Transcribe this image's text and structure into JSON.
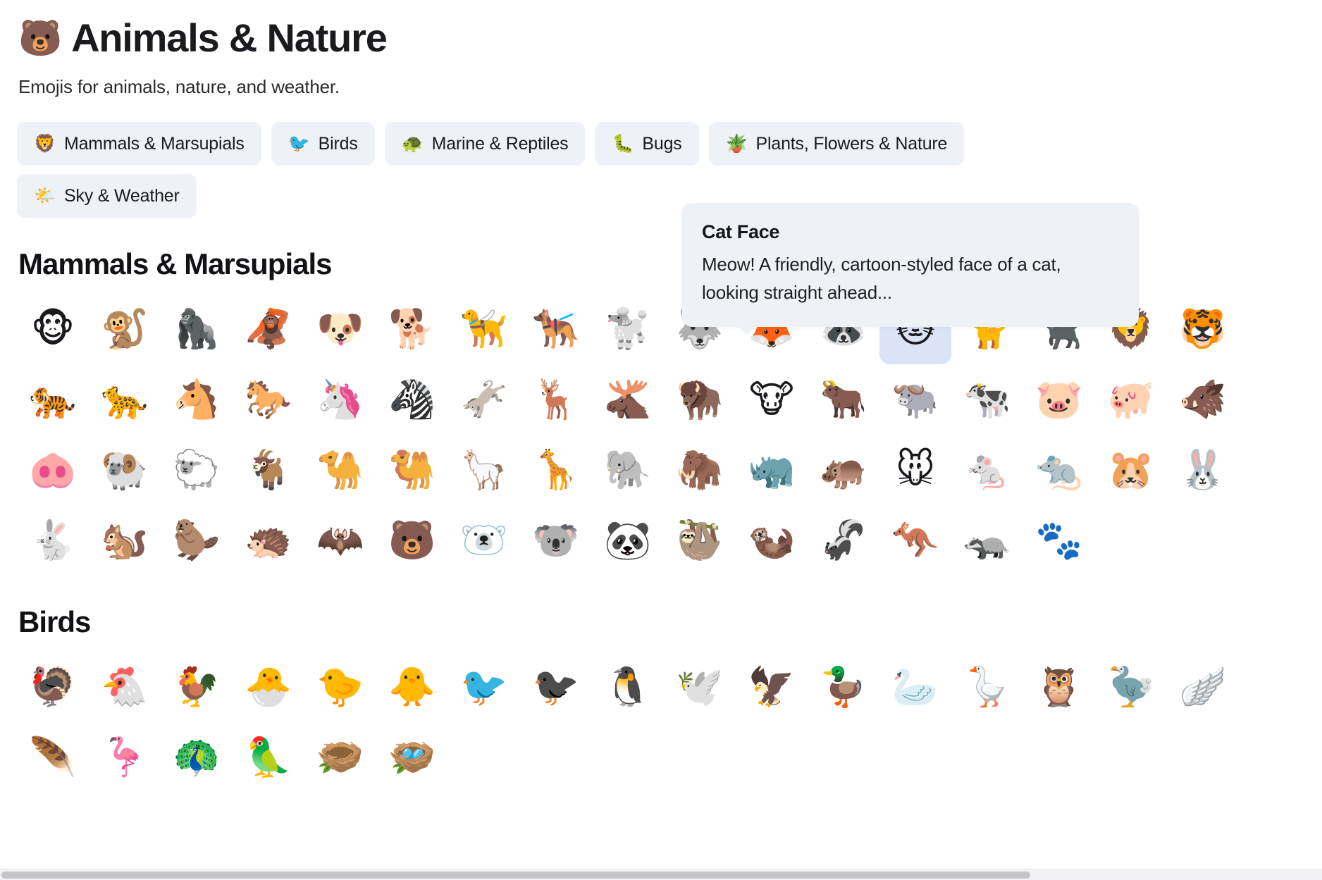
{
  "header": {
    "title_emoji": "🐻",
    "title_emoji_name": "bear-face-icon",
    "title": "Animals & Nature",
    "subtitle": "Emojis for animals, nature, and weather."
  },
  "chips": [
    {
      "emoji": "🦁",
      "icon_name": "lion-face-icon",
      "label": "Mammals & Marsupials"
    },
    {
      "emoji": "🐦",
      "icon_name": "bird-icon",
      "label": "Birds"
    },
    {
      "emoji": "🐢",
      "icon_name": "turtle-icon",
      "label": "Marine & Reptiles"
    },
    {
      "emoji": "🐛",
      "icon_name": "caterpillar-icon",
      "label": "Bugs"
    },
    {
      "emoji": "🪴",
      "icon_name": "potted-plant-icon",
      "label": "Plants, Flowers & Nature"
    },
    {
      "emoji": "🌤️",
      "icon_name": "sun-behind-cloud-icon",
      "label": "Sky & Weather"
    }
  ],
  "tooltip": {
    "title": "Cat Face",
    "body": "Meow! A friendly, cartoon-styled face of a cat, looking straight ahead...",
    "target_index": 12,
    "target_section": 0
  },
  "selection": {
    "section": 0,
    "index": 12,
    "highlight_color": "#dbe4f7"
  },
  "sections": [
    {
      "heading": "Mammals & Marsupials",
      "emojis": [
        {
          "glyph": "🐵",
          "name": "monkey-face"
        },
        {
          "glyph": "🐒",
          "name": "monkey"
        },
        {
          "glyph": "🦍",
          "name": "gorilla"
        },
        {
          "glyph": "🦧",
          "name": "orangutan"
        },
        {
          "glyph": "🐶",
          "name": "dog-face"
        },
        {
          "glyph": "🐕",
          "name": "dog"
        },
        {
          "glyph": "🦮",
          "name": "guide-dog"
        },
        {
          "glyph": "🐕‍🦺",
          "name": "service-dog"
        },
        {
          "glyph": "🐩",
          "name": "poodle"
        },
        {
          "glyph": "🐺",
          "name": "wolf"
        },
        {
          "glyph": "🦊",
          "name": "fox"
        },
        {
          "glyph": "🦝",
          "name": "raccoon"
        },
        {
          "glyph": "🐱",
          "name": "cat-face"
        },
        {
          "glyph": "🐈",
          "name": "cat"
        },
        {
          "glyph": "🐈‍⬛",
          "name": "black-cat"
        },
        {
          "glyph": "🦁",
          "name": "lion"
        },
        {
          "glyph": "🐯",
          "name": "tiger-face"
        },
        {
          "glyph": "🐅",
          "name": "tiger"
        },
        {
          "glyph": "🐆",
          "name": "leopard"
        },
        {
          "glyph": "🐴",
          "name": "horse-face"
        },
        {
          "glyph": "🐎",
          "name": "horse"
        },
        {
          "glyph": "🦄",
          "name": "unicorn"
        },
        {
          "glyph": "🦓",
          "name": "zebra"
        },
        {
          "glyph": "🫏",
          "name": "donkey"
        },
        {
          "glyph": "🦌",
          "name": "deer"
        },
        {
          "glyph": "🫎",
          "name": "moose"
        },
        {
          "glyph": "🦬",
          "name": "bison"
        },
        {
          "glyph": "🐮",
          "name": "cow-face"
        },
        {
          "glyph": "🐂",
          "name": "ox"
        },
        {
          "glyph": "🐃",
          "name": "water-buffalo"
        },
        {
          "glyph": "🐄",
          "name": "cow"
        },
        {
          "glyph": "🐷",
          "name": "pig-face"
        },
        {
          "glyph": "🐖",
          "name": "pig"
        },
        {
          "glyph": "🐗",
          "name": "boar"
        },
        {
          "glyph": "🐽",
          "name": "pig-nose"
        },
        {
          "glyph": "🐏",
          "name": "ram"
        },
        {
          "glyph": "🐑",
          "name": "ewe"
        },
        {
          "glyph": "🐐",
          "name": "goat"
        },
        {
          "glyph": "🐪",
          "name": "camel"
        },
        {
          "glyph": "🐫",
          "name": "two-hump-camel"
        },
        {
          "glyph": "🦙",
          "name": "llama"
        },
        {
          "glyph": "🦒",
          "name": "giraffe"
        },
        {
          "glyph": "🐘",
          "name": "elephant"
        },
        {
          "glyph": "🦣",
          "name": "mammoth"
        },
        {
          "glyph": "🦏",
          "name": "rhinoceros"
        },
        {
          "glyph": "🦛",
          "name": "hippopotamus"
        },
        {
          "glyph": "🐭",
          "name": "mouse-face"
        },
        {
          "glyph": "🐁",
          "name": "mouse"
        },
        {
          "glyph": "🐀",
          "name": "rat"
        },
        {
          "glyph": "🐹",
          "name": "hamster"
        },
        {
          "glyph": "🐰",
          "name": "rabbit-face"
        },
        {
          "glyph": "🐇",
          "name": "rabbit"
        },
        {
          "glyph": "🐿️",
          "name": "chipmunk"
        },
        {
          "glyph": "🦫",
          "name": "beaver"
        },
        {
          "glyph": "🦔",
          "name": "hedgehog"
        },
        {
          "glyph": "🦇",
          "name": "bat"
        },
        {
          "glyph": "🐻",
          "name": "bear"
        },
        {
          "glyph": "🐻‍❄️",
          "name": "polar-bear"
        },
        {
          "glyph": "🐨",
          "name": "koala"
        },
        {
          "glyph": "🐼",
          "name": "panda"
        },
        {
          "glyph": "🦥",
          "name": "sloth"
        },
        {
          "glyph": "🦦",
          "name": "otter"
        },
        {
          "glyph": "🦨",
          "name": "skunk"
        },
        {
          "glyph": "🦘",
          "name": "kangaroo"
        },
        {
          "glyph": "🦡",
          "name": "badger"
        },
        {
          "glyph": "🐾",
          "name": "paw-prints"
        }
      ]
    },
    {
      "heading": "Birds",
      "emojis": [
        {
          "glyph": "🦃",
          "name": "turkey"
        },
        {
          "glyph": "🐔",
          "name": "chicken"
        },
        {
          "glyph": "🐓",
          "name": "rooster"
        },
        {
          "glyph": "🐣",
          "name": "hatching-chick"
        },
        {
          "glyph": "🐤",
          "name": "baby-chick"
        },
        {
          "glyph": "🐥",
          "name": "front-facing-baby-chick"
        },
        {
          "glyph": "🐦",
          "name": "bird"
        },
        {
          "glyph": "🐦‍⬛",
          "name": "black-bird"
        },
        {
          "glyph": "🐧",
          "name": "penguin"
        },
        {
          "glyph": "🕊️",
          "name": "dove"
        },
        {
          "glyph": "🦅",
          "name": "eagle"
        },
        {
          "glyph": "🦆",
          "name": "duck"
        },
        {
          "glyph": "🦢",
          "name": "swan"
        },
        {
          "glyph": "🪿",
          "name": "goose"
        },
        {
          "glyph": "🦉",
          "name": "owl"
        },
        {
          "glyph": "🦤",
          "name": "dodo"
        },
        {
          "glyph": "🪽",
          "name": "wing"
        },
        {
          "glyph": "🪶",
          "name": "feather"
        },
        {
          "glyph": "🦩",
          "name": "flamingo"
        },
        {
          "glyph": "🦚",
          "name": "peacock"
        },
        {
          "glyph": "🦜",
          "name": "parrot"
        },
        {
          "glyph": "🪹",
          "name": "empty-nest"
        },
        {
          "glyph": "🪺",
          "name": "nest-with-eggs"
        }
      ]
    }
  ],
  "scrollbar": {
    "orientation": "horizontal",
    "thumb_fraction": 0.78
  }
}
